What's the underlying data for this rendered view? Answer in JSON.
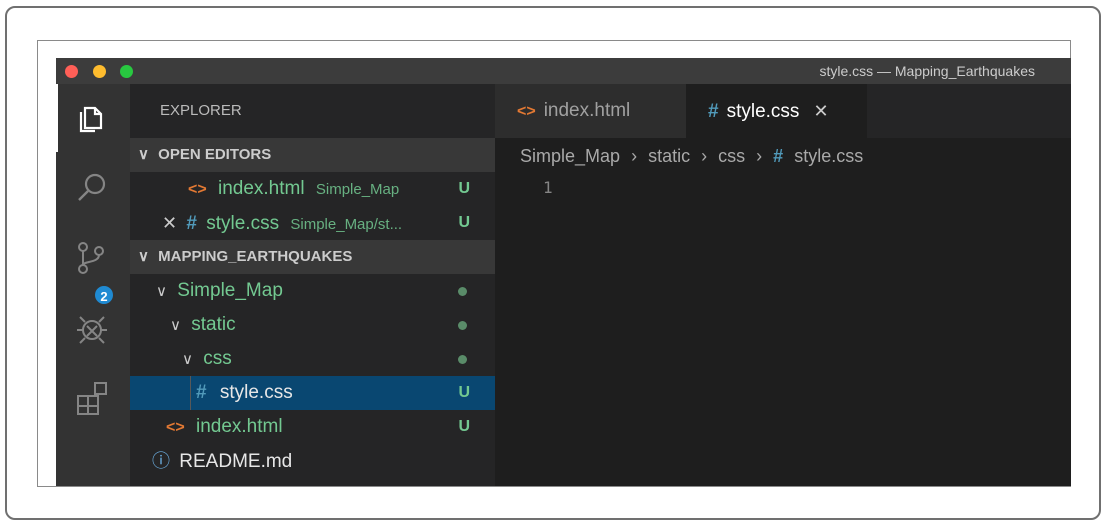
{
  "window": {
    "title": "style.css — Mapping_Earthquakes"
  },
  "activity_bar": {
    "icons": [
      "files-icon",
      "search-icon",
      "source-control-icon",
      "debug-icon",
      "extensions-icon"
    ],
    "source_control_badge": "2"
  },
  "sidebar": {
    "title": "EXPLORER",
    "open_editors": {
      "header": "OPEN EDITORS",
      "items": [
        {
          "name": "index.html",
          "description": "Simple_Map",
          "status": "U"
        },
        {
          "name": "style.css",
          "description": "Simple_Map/st...",
          "status": "U"
        }
      ]
    },
    "project": {
      "header": "MAPPING_EARTHQUAKES",
      "tree": [
        {
          "name": "Simple_Map"
        },
        {
          "name": "static"
        },
        {
          "name": "css"
        },
        {
          "name": "style.css",
          "status": "U"
        },
        {
          "name": "index.html",
          "status": "U"
        },
        {
          "name": "README.md"
        }
      ]
    }
  },
  "editor": {
    "tabs": [
      {
        "label": "index.html",
        "active": false
      },
      {
        "label": "style.css",
        "active": true
      }
    ],
    "breadcrumb": [
      "Simple_Map",
      "static",
      "css",
      "style.css"
    ],
    "line_numbers": [
      "1"
    ]
  },
  "colors": {
    "untracked_green": "#73c991",
    "css_hash_blue": "#519aba",
    "html_orange": "#e37933",
    "selection_blue": "#094771",
    "badge_blue": "#1f8ad2"
  }
}
